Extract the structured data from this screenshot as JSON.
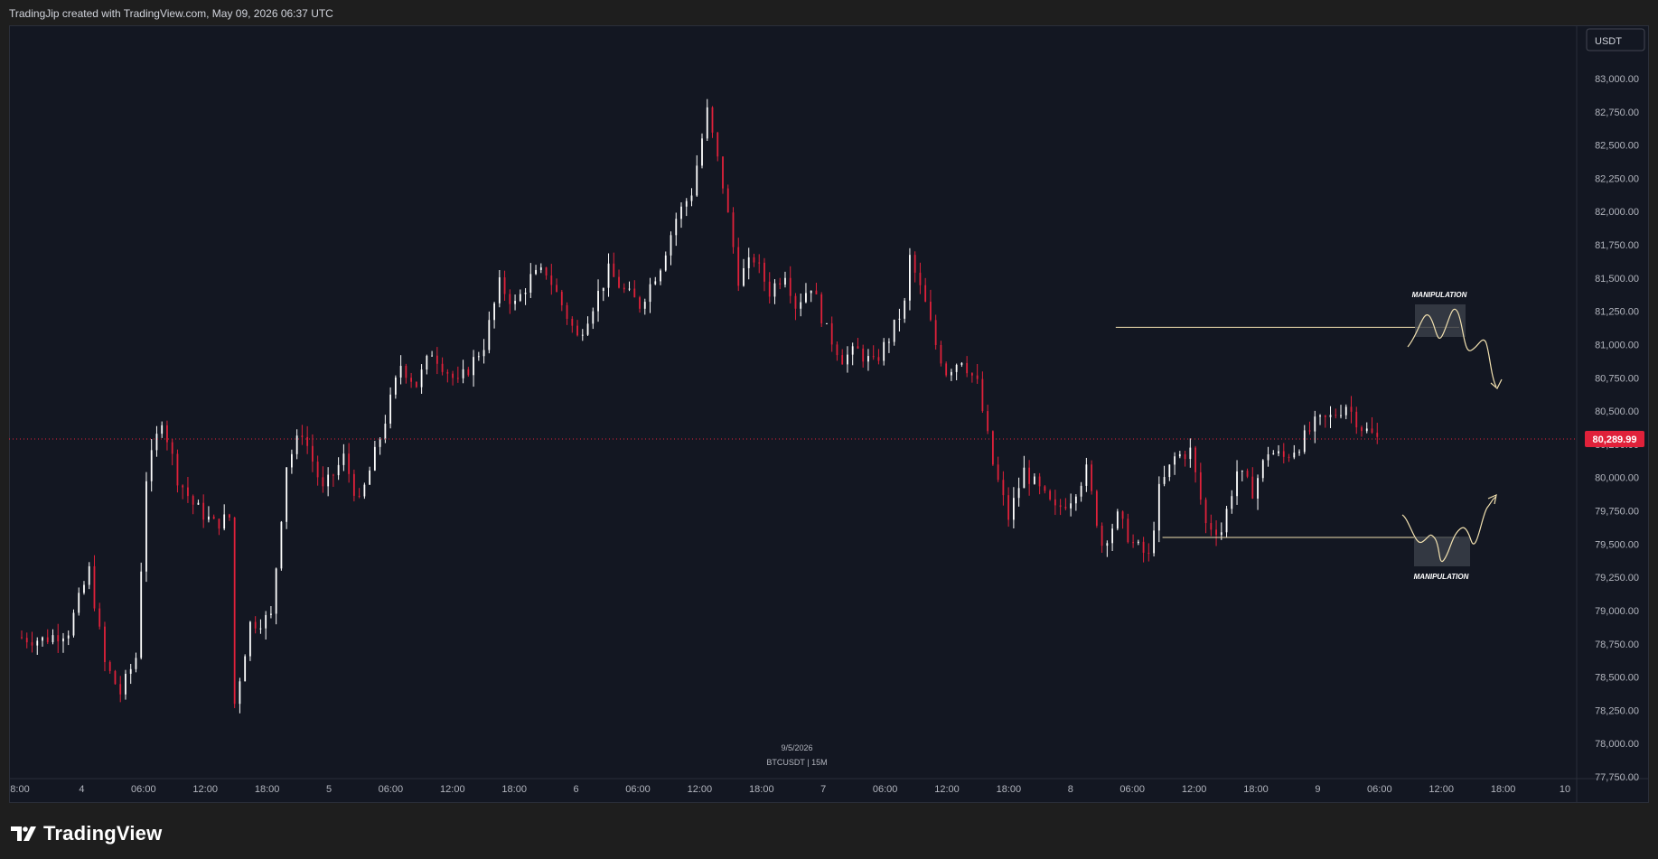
{
  "header": {
    "attribution": "TradingJip created with TradingView.com, May 09, 2026 06:37 UTC"
  },
  "footer": {
    "brand": "TradingView"
  },
  "colors": {
    "background": "#131722",
    "outer_background": "#1e1e1e",
    "up_candle": "#ffffff",
    "down_candle": "#e0213a",
    "price_line": "#e0213a",
    "annotation_line": "#f2e1b0",
    "axis_text": "#b2b5be"
  },
  "chart_data": {
    "type": "candlestick",
    "symbol_label": "BTCUSDT | 15M",
    "date_label": "9/5/2026",
    "currency": "USDT",
    "ylim": [
      77750,
      83000
    ],
    "y_ticks": [
      "83,000.00",
      "82,750.00",
      "82,500.00",
      "82,250.00",
      "82,000.00",
      "81,750.00",
      "81,500.00",
      "81,250.00",
      "81,000.00",
      "80,750.00",
      "80,500.00",
      "80,250.00",
      "80,000.00",
      "79,750.00",
      "79,500.00",
      "79,250.00",
      "79,000.00",
      "78,750.00",
      "78,500.00",
      "78,250.00",
      "78,000.00",
      "77,750.00"
    ],
    "x_ticks": [
      "8:00",
      "4",
      "06:00",
      "12:00",
      "18:00",
      "5",
      "06:00",
      "12:00",
      "18:00",
      "6",
      "06:00",
      "12:00",
      "18:00",
      "7",
      "06:00",
      "12:00",
      "18:00",
      "8",
      "06:00",
      "12:00",
      "18:00",
      "9",
      "06:00",
      "12:00",
      "18:00",
      "10"
    ],
    "current_price": 80289.99,
    "current_price_label": "80,289.99",
    "price_path": [
      [
        0,
        78800
      ],
      [
        5,
        78780
      ],
      [
        10,
        78850
      ],
      [
        14,
        79300
      ],
      [
        17,
        78600
      ],
      [
        20,
        78380
      ],
      [
        23,
        78650
      ],
      [
        25,
        80000
      ],
      [
        28,
        80450
      ],
      [
        31,
        80000
      ],
      [
        34,
        79800
      ],
      [
        38,
        79650
      ],
      [
        41,
        79700
      ],
      [
        42,
        78300
      ],
      [
        45,
        78900
      ],
      [
        49,
        78950
      ],
      [
        52,
        80100
      ],
      [
        55,
        80350
      ],
      [
        59,
        79900
      ],
      [
        63,
        80150
      ],
      [
        66,
        79800
      ],
      [
        70,
        80300
      ],
      [
        74,
        80850
      ],
      [
        77,
        80700
      ],
      [
        80,
        80950
      ],
      [
        85,
        80700
      ],
      [
        90,
        81000
      ],
      [
        93,
        81450
      ],
      [
        96,
        81300
      ],
      [
        99,
        81500
      ],
      [
        102,
        81550
      ],
      [
        105,
        81300
      ],
      [
        108,
        81050
      ],
      [
        111,
        81300
      ],
      [
        114,
        81550
      ],
      [
        117,
        81400
      ],
      [
        120,
        81300
      ],
      [
        124,
        81600
      ],
      [
        127,
        81950
      ],
      [
        130,
        82150
      ],
      [
        133,
        82750
      ],
      [
        136,
        82200
      ],
      [
        139,
        81500
      ],
      [
        142,
        81650
      ],
      [
        145,
        81400
      ],
      [
        148,
        81550
      ],
      [
        150,
        81300
      ],
      [
        153,
        81450
      ],
      [
        156,
        81100
      ],
      [
        159,
        80900
      ],
      [
        162,
        80950
      ],
      [
        165,
        80850
      ],
      [
        168,
        81050
      ],
      [
        171,
        81300
      ],
      [
        172,
        81650
      ],
      [
        175,
        81300
      ],
      [
        177,
        81000
      ],
      [
        179,
        80800
      ],
      [
        182,
        80900
      ],
      [
        185,
        80700
      ],
      [
        186,
        80500
      ],
      [
        188,
        80100
      ],
      [
        191,
        79700
      ],
      [
        194,
        80050
      ],
      [
        197,
        79900
      ],
      [
        200,
        79750
      ],
      [
        203,
        79850
      ],
      [
        206,
        80050
      ],
      [
        209,
        79500
      ],
      [
        212,
        79700
      ],
      [
        215,
        79500
      ],
      [
        218,
        79400
      ],
      [
        220,
        79900
      ],
      [
        223,
        80150
      ],
      [
        226,
        80200
      ],
      [
        229,
        79650
      ],
      [
        232,
        79600
      ],
      [
        235,
        80050
      ],
      [
        238,
        79900
      ],
      [
        241,
        80200
      ],
      [
        244,
        80150
      ],
      [
        247,
        80250
      ],
      [
        250,
        80400
      ],
      [
        253,
        80450
      ],
      [
        256,
        80550
      ],
      [
        259,
        80380
      ],
      [
        262,
        80290
      ]
    ],
    "annotations": [
      {
        "text": "MANIPULATION",
        "level": 81130,
        "position": "upper-right",
        "arrow": "down"
      },
      {
        "text": "MANIPULATION",
        "level": 79550,
        "position": "lower-right",
        "arrow": "up"
      }
    ]
  }
}
